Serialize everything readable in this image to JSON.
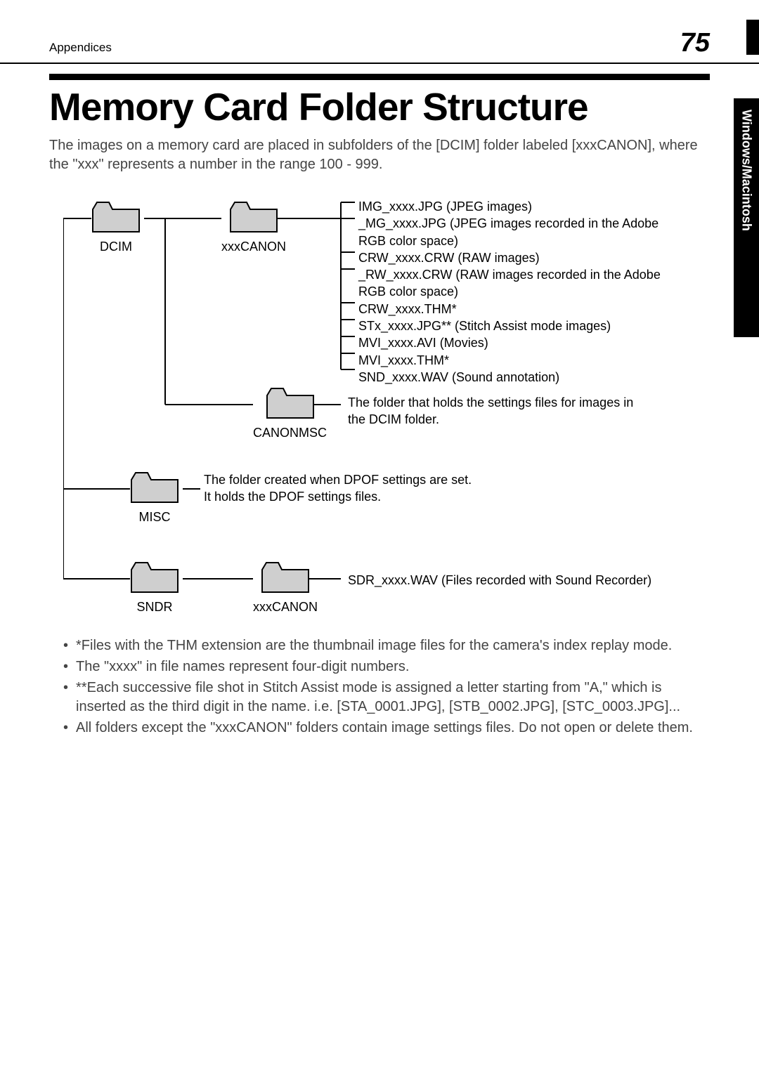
{
  "header": {
    "section": "Appendices",
    "page": "75"
  },
  "sideTab": "Windows/Macintosh",
  "title": "Memory Card Folder Structure",
  "intro": "The images on a memory card are placed in subfolders of the [DCIM] folder labeled [xxxCANON], where the \"xxx\" represents a number in the range 100 - 999.",
  "folders": {
    "dcim": "DCIM",
    "xxxcanon": "xxxCANON",
    "canonmsc": "CANONMSC",
    "misc": "MISC",
    "sndr": "SNDR",
    "xxxcanon2": "xxxCANON"
  },
  "fileList": [
    "IMG_xxxx.JPG (JPEG images)",
    "_MG_xxxx.JPG (JPEG images recorded in the Adobe RGB color space)",
    "CRW_xxxx.CRW (RAW images)",
    "_RW_xxxx.CRW (RAW images recorded in the Adobe RGB color space)",
    "CRW_xxxx.THM*",
    "STx_xxxx.JPG** (Stitch Assist mode images)",
    "MVI_xxxx.AVI (Movies)",
    "MVI_xxxx.THM*",
    "SND_xxxx.WAV (Sound annotation)"
  ],
  "canonmscDesc": "The folder that holds the settings files for images in the DCIM folder.",
  "miscDesc1": "The folder created when DPOF settings are set.",
  "miscDesc2": "It holds the DPOF settings files.",
  "sndrDesc": "SDR_xxxx.WAV (Files recorded with Sound Recorder)",
  "bullets": [
    "*Files with the THM extension are the thumbnail image files for the camera's index replay mode.",
    "The \"xxxx\" in file names represent four-digit numbers.",
    "**Each successive file shot in Stitch Assist mode is assigned a letter starting from \"A,\" which is inserted as the third digit in the name. i.e. [STA_0001.JPG], [STB_0002.JPG], [STC_0003.JPG]...",
    "All folders except the \"xxxCANON\" folders contain image settings files. Do not open or delete them."
  ]
}
